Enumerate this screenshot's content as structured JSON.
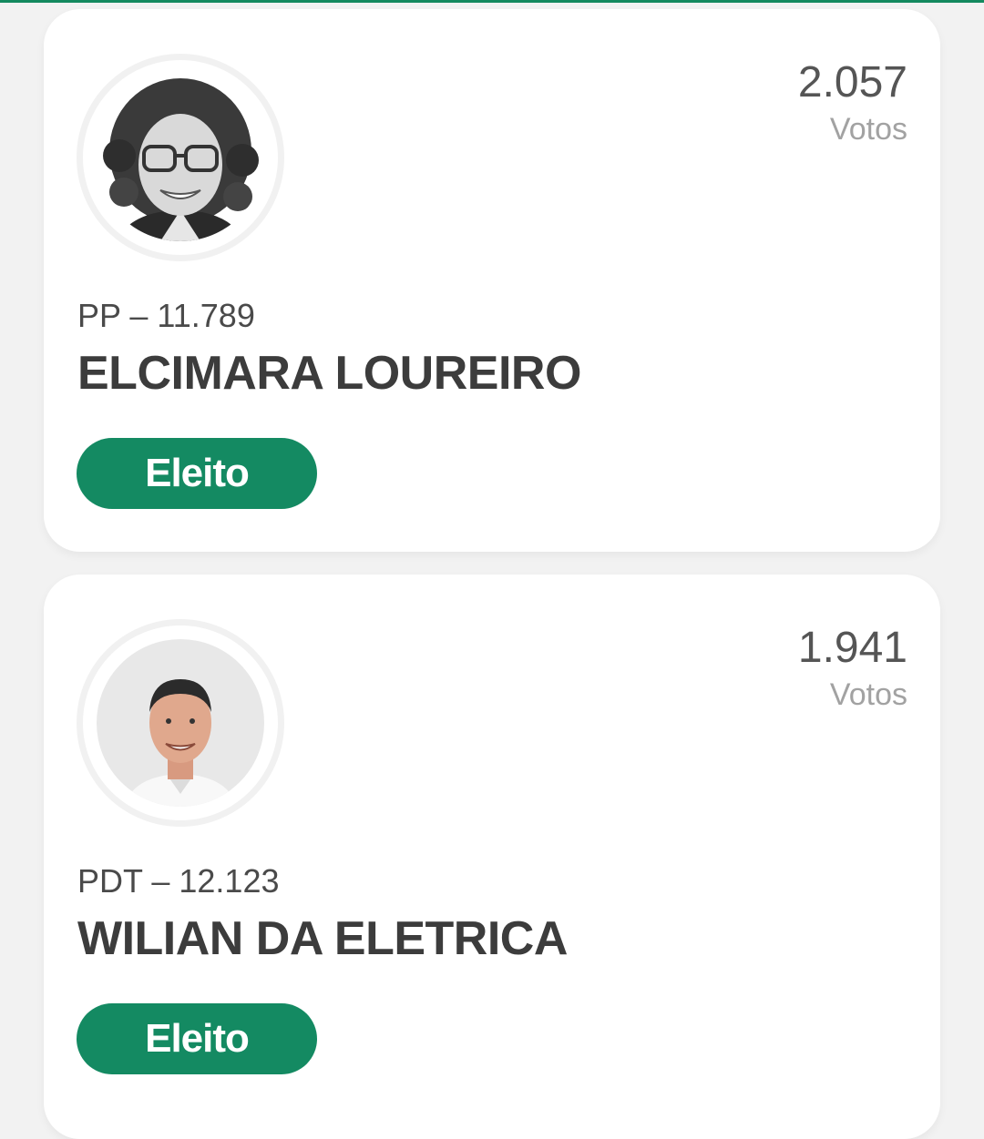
{
  "candidates": [
    {
      "votes": "2.057",
      "votes_label": "Votos",
      "party": "PP – 11.789",
      "name": "ELCIMARA LOUREIRO",
      "status": "Eleito",
      "photo_icon": "candidate-photo-woman"
    },
    {
      "votes": "1.941",
      "votes_label": "Votos",
      "party": "PDT – 12.123",
      "name": "WILIAN DA ELETRICA",
      "status": "Eleito",
      "photo_icon": "candidate-photo-man"
    }
  ],
  "colors": {
    "accent": "#148a62",
    "background": "#f2f2f2",
    "card": "#ffffff",
    "name_text": "#3c3c3c",
    "votes_label": "#a2a2a2"
  }
}
